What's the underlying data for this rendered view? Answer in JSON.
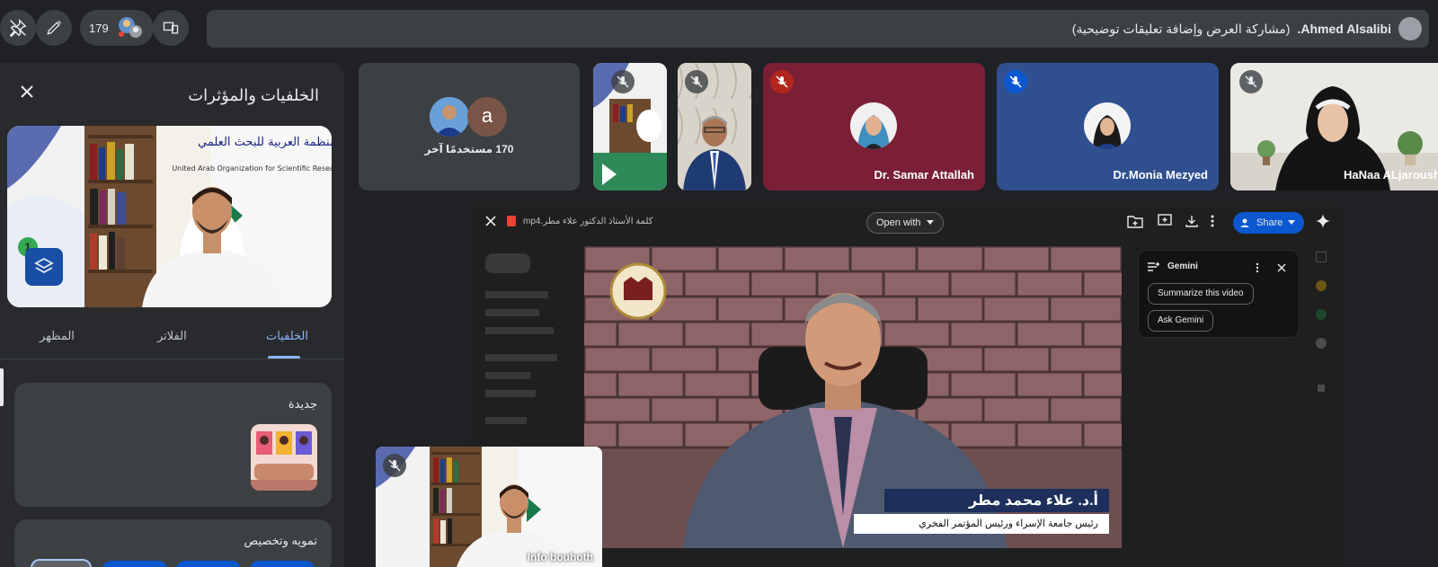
{
  "topbar": {
    "participant_count": "179",
    "presenting_name": "Ahmed Alsalibi.",
    "presenting_status": "(مشاركة العرض وإضافة تعليقات توضيحية)"
  },
  "panel": {
    "title": "الخلفيات والمؤثرات",
    "badge": "1",
    "tabs": [
      "الخلفيات",
      "الفلاتر",
      "المظهر"
    ],
    "new_section": "جديدة",
    "blur_section": "تمويه وتخصيص"
  },
  "preview_poster": {
    "arabic_line": "المنظمة العربية للبحث العلمي",
    "english_line": "United Arab Organization for Scientific Research (UAO)"
  },
  "tiles": {
    "others_count": "170 مستخدمًا آخر",
    "others_avatar_letter": "a",
    "samar": "Dr. Samar Attallah",
    "monia": "Dr.Monia Mezyed",
    "hanaa": "HaNaa ALjaroushah"
  },
  "share": {
    "file_name": "كلمة الأستاذ الدكتور علاء مطر.mp4",
    "open_with": "Open with",
    "share_label": "Share",
    "gemini_title": "Gemini",
    "summarize": "Summarize this video",
    "ask_gemini": "Ask Gemini",
    "speaker_name": "أ.د. علاء محمد مطر",
    "speaker_role": "رئيس جامعة الإسراء ورئيس المؤتمر الفخري"
  },
  "selfview": {
    "name": "Info bouhoth"
  },
  "colors": {
    "background": "#202124",
    "accent": "#8ab4f8",
    "mic_off_red": "#b3261e",
    "mic_off_blue": "#0b57d0"
  }
}
